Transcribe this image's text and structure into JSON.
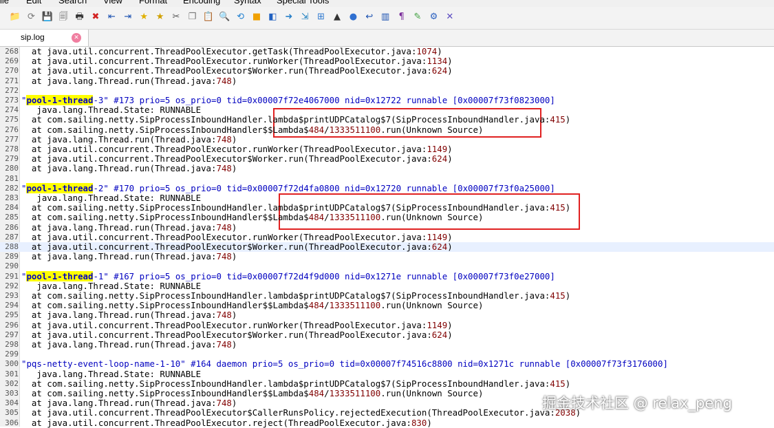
{
  "menu": [
    "ile",
    "Edit",
    "Search",
    "View",
    "Format",
    "Encoding",
    "Syntax",
    "Special Tools"
  ],
  "toolbar": [
    {
      "icon": "folder-open-icon",
      "glyph": "📁",
      "color": "#e2a31c"
    },
    {
      "icon": "reload-icon",
      "glyph": "⟳",
      "color": "#777777"
    },
    {
      "icon": "save-icon",
      "glyph": "💾",
      "color": "#555555"
    },
    {
      "icon": "save-all-icon",
      "glyph": "🗐",
      "color": "#555555"
    },
    {
      "icon": "print-icon",
      "glyph": "🖶",
      "color": "#333333"
    },
    {
      "icon": "close-icon",
      "glyph": "✖",
      "color": "#d22222"
    },
    {
      "icon": "outdent-icon",
      "glyph": "⇤",
      "color": "#1a50b0"
    },
    {
      "icon": "indent-icon",
      "glyph": "⇥",
      "color": "#1a50b0"
    },
    {
      "icon": "bookmark-add-icon",
      "glyph": "★",
      "color": "#e0b000"
    },
    {
      "icon": "bookmark-icon",
      "glyph": "★",
      "color": "#d0a000"
    },
    {
      "icon": "cut-icon",
      "glyph": "✂",
      "color": "#555555"
    },
    {
      "icon": "copy-icon",
      "glyph": "❐",
      "color": "#777777"
    },
    {
      "icon": "paste-icon",
      "glyph": "📋",
      "color": "#a07020"
    },
    {
      "icon": "find-icon",
      "glyph": "🔍",
      "color": "#2060c0"
    },
    {
      "icon": "replace-icon",
      "glyph": "⟲",
      "color": "#2080d0"
    },
    {
      "icon": "highlight-icon",
      "glyph": "■",
      "color": "#f0a000"
    },
    {
      "icon": "mark-icon",
      "glyph": "◧",
      "color": "#2060c0"
    },
    {
      "icon": "go-to-icon",
      "glyph": "➜",
      "color": "#2a80c8"
    },
    {
      "icon": "goto-line-icon",
      "glyph": "⇲",
      "color": "#2080c0"
    },
    {
      "icon": "windows-icon",
      "glyph": "⊞",
      "color": "#2f7ad0"
    },
    {
      "icon": "linux-icon",
      "glyph": "▲",
      "color": "#333333"
    },
    {
      "icon": "apple-icon",
      "glyph": "●",
      "color": "#3070d0"
    },
    {
      "icon": "word-wrap-icon",
      "glyph": "↩",
      "color": "#1a50b0"
    },
    {
      "icon": "column-icon",
      "glyph": "▥",
      "color": "#1a50b0"
    },
    {
      "icon": "pilcrow-icon",
      "glyph": "¶",
      "color": "#7a2a9a"
    },
    {
      "icon": "pencil-icon",
      "glyph": "✎",
      "color": "#40a040"
    },
    {
      "icon": "settings-icon",
      "glyph": "⚙",
      "color": "#2a60c0"
    },
    {
      "icon": "macro-icon",
      "glyph": "✕",
      "color": "#5a4ac0"
    }
  ],
  "tab": {
    "label": "sip.log",
    "close_glyph": "✕"
  },
  "lines": [
    {
      "n": "268",
      "segs": [
        [
          "  at java.util.concurrent.ThreadPoolExecutor.getTask(ThreadPoolExecutor.java:",
          ""
        ],
        [
          "1074",
          "num"
        ],
        [
          ")",
          ""
        ]
      ]
    },
    {
      "n": "269",
      "segs": [
        [
          "  at java.util.concurrent.ThreadPoolExecutor.runWorker(ThreadPoolExecutor.java:",
          ""
        ],
        [
          "1134",
          "num"
        ],
        [
          ")",
          ""
        ]
      ]
    },
    {
      "n": "270",
      "segs": [
        [
          "  at java.util.concurrent.ThreadPoolExecutor$Worker.run(ThreadPoolExecutor.java:",
          ""
        ],
        [
          "624",
          "num"
        ],
        [
          ")",
          ""
        ]
      ]
    },
    {
      "n": "271",
      "segs": [
        [
          "  at java.lang.Thread.run(Thread.java:",
          ""
        ],
        [
          "748",
          "num"
        ],
        [
          ")",
          ""
        ]
      ]
    },
    {
      "n": "272",
      "segs": []
    },
    {
      "n": "273",
      "segs": [
        [
          "\"",
          "str"
        ],
        [
          "pool-1-thread",
          "hl"
        ],
        [
          "-3\"",
          "str"
        ],
        [
          " #173 prio=5 os_prio=0 tid=0x00007f72e4067000 nid=0x12722 runnable [0x00007f73f0823000]",
          "kw"
        ]
      ]
    },
    {
      "n": "274",
      "segs": [
        [
          "   java.lang.Thread.State: RUNNABLE",
          ""
        ]
      ]
    },
    {
      "n": "275",
      "segs": [
        [
          "  at com.sailing.netty.SipProcessInboundHandler.lambda$printUDPCatalog$7(SipProcessInboundHandler.java:",
          ""
        ],
        [
          "415",
          "num"
        ],
        [
          ")",
          ""
        ]
      ]
    },
    {
      "n": "276",
      "segs": [
        [
          "  at com.sailing.netty.SipProcessInboundHandler$$Lambda$",
          ""
        ],
        [
          "484",
          "num"
        ],
        [
          "/",
          ""
        ],
        [
          "1333511100",
          "num"
        ],
        [
          ".run(Unknown Source)",
          ""
        ]
      ]
    },
    {
      "n": "277",
      "segs": [
        [
          "  at java.lang.Thread.run(Thread.java:",
          ""
        ],
        [
          "748",
          "num"
        ],
        [
          ")",
          ""
        ]
      ]
    },
    {
      "n": "278",
      "segs": [
        [
          "  at java.util.concurrent.ThreadPoolExecutor.runWorker(ThreadPoolExecutor.java:",
          ""
        ],
        [
          "1149",
          "num"
        ],
        [
          ")",
          ""
        ]
      ]
    },
    {
      "n": "279",
      "segs": [
        [
          "  at java.util.concurrent.ThreadPoolExecutor$Worker.run(ThreadPoolExecutor.java:",
          ""
        ],
        [
          "624",
          "num"
        ],
        [
          ")",
          ""
        ]
      ]
    },
    {
      "n": "280",
      "segs": [
        [
          "  at java.lang.Thread.run(Thread.java:",
          ""
        ],
        [
          "748",
          "num"
        ],
        [
          ")",
          ""
        ]
      ]
    },
    {
      "n": "281",
      "segs": []
    },
    {
      "n": "282",
      "segs": [
        [
          "\"",
          "str"
        ],
        [
          "pool-1-thread",
          "hl"
        ],
        [
          "-2\"",
          "str"
        ],
        [
          " #170 prio=5 os_prio=0 tid=0x00007f72d4fa0800 nid=0x12720 runnable [0x00007f73f0a25000]",
          "kw"
        ]
      ]
    },
    {
      "n": "283",
      "segs": [
        [
          "   java.lang.Thread.State: RUNNABLE",
          ""
        ]
      ]
    },
    {
      "n": "284",
      "segs": [
        [
          "  at com.sailing.netty.SipProcessInboundHandler.lambda$printUDPCatalog$7(SipProcessInboundHandler.java:",
          ""
        ],
        [
          "415",
          "num"
        ],
        [
          ")",
          ""
        ]
      ]
    },
    {
      "n": "285",
      "segs": [
        [
          "  at com.sailing.netty.SipProcessInboundHandler$$Lambda$",
          ""
        ],
        [
          "484",
          "num"
        ],
        [
          "/",
          ""
        ],
        [
          "1333511100",
          "num"
        ],
        [
          ".run(Unknown Source)",
          ""
        ]
      ]
    },
    {
      "n": "286",
      "segs": [
        [
          "  at java.lang.Thread.run(Thread.java:",
          ""
        ],
        [
          "748",
          "num"
        ],
        [
          ")",
          ""
        ]
      ]
    },
    {
      "n": "287",
      "segs": [
        [
          "  at java.util.concurrent.ThreadPoolExecutor.runWorker(ThreadPoolExecutor.java:",
          ""
        ],
        [
          "1149",
          "num"
        ],
        [
          ")",
          ""
        ]
      ]
    },
    {
      "n": "288",
      "segs": [
        [
          "  at java.util.concurrent.ThreadPoolExecutor$Worker.run(ThreadPoolExecutor.java:",
          ""
        ],
        [
          "624",
          "num"
        ],
        [
          ")",
          ""
        ]
      ],
      "current": true
    },
    {
      "n": "289",
      "segs": [
        [
          "  at java.lang.Thread.run(Thread.java:",
          ""
        ],
        [
          "748",
          "num"
        ],
        [
          ")",
          ""
        ]
      ]
    },
    {
      "n": "290",
      "segs": []
    },
    {
      "n": "291",
      "segs": [
        [
          "\"",
          "str"
        ],
        [
          "pool-1-thread",
          "hl"
        ],
        [
          "-1\"",
          "str"
        ],
        [
          " #167 prio=5 os_prio=0 tid=0x00007f72d4f9d000 nid=0x1271e runnable [0x00007f73f0e27000]",
          "kw"
        ]
      ]
    },
    {
      "n": "292",
      "segs": [
        [
          "   java.lang.Thread.State: RUNNABLE",
          ""
        ]
      ]
    },
    {
      "n": "293",
      "segs": [
        [
          "  at com.sailing.netty.SipProcessInboundHandler.lambda$printUDPCatalog$7(SipProcessInboundHandler.java:",
          ""
        ],
        [
          "415",
          "num"
        ],
        [
          ")",
          ""
        ]
      ]
    },
    {
      "n": "294",
      "segs": [
        [
          "  at com.sailing.netty.SipProcessInboundHandler$$Lambda$",
          ""
        ],
        [
          "484",
          "num"
        ],
        [
          "/",
          ""
        ],
        [
          "1333511100",
          "num"
        ],
        [
          ".run(Unknown Source)",
          ""
        ]
      ]
    },
    {
      "n": "295",
      "segs": [
        [
          "  at java.lang.Thread.run(Thread.java:",
          ""
        ],
        [
          "748",
          "num"
        ],
        [
          ")",
          ""
        ]
      ]
    },
    {
      "n": "296",
      "segs": [
        [
          "  at java.util.concurrent.ThreadPoolExecutor.runWorker(ThreadPoolExecutor.java:",
          ""
        ],
        [
          "1149",
          "num"
        ],
        [
          ")",
          ""
        ]
      ]
    },
    {
      "n": "297",
      "segs": [
        [
          "  at java.util.concurrent.ThreadPoolExecutor$Worker.run(ThreadPoolExecutor.java:",
          ""
        ],
        [
          "624",
          "num"
        ],
        [
          ")",
          ""
        ]
      ]
    },
    {
      "n": "298",
      "segs": [
        [
          "  at java.lang.Thread.run(Thread.java:",
          ""
        ],
        [
          "748",
          "num"
        ],
        [
          ")",
          ""
        ]
      ]
    },
    {
      "n": "299",
      "segs": []
    },
    {
      "n": "300",
      "segs": [
        [
          "\"pqs-netty-event-loop-name-1-10\"",
          "str"
        ],
        [
          " #164 daemon prio=5 os_prio=0 tid=0x00007f74516c8800 nid=0x1271c runnable [0x00007f73f3176000]",
          "kw"
        ]
      ]
    },
    {
      "n": "301",
      "segs": [
        [
          "   java.lang.Thread.State: RUNNABLE",
          ""
        ]
      ]
    },
    {
      "n": "302",
      "segs": [
        [
          "  at com.sailing.netty.SipProcessInboundHandler.lambda$printUDPCatalog$7(SipProcessInboundHandler.java:",
          ""
        ],
        [
          "415",
          "num"
        ],
        [
          ")",
          ""
        ]
      ]
    },
    {
      "n": "303",
      "segs": [
        [
          "  at com.sailing.netty.SipProcessInboundHandler$$Lambda$",
          ""
        ],
        [
          "484",
          "num"
        ],
        [
          "/",
          ""
        ],
        [
          "1333511100",
          "num"
        ],
        [
          ".run(Unknown Source)",
          ""
        ]
      ]
    },
    {
      "n": "304",
      "segs": [
        [
          "  at java.lang.Thread.run(Thread.java:",
          ""
        ],
        [
          "748",
          "num"
        ],
        [
          ")",
          ""
        ]
      ]
    },
    {
      "n": "305",
      "segs": [
        [
          "  at java.util.concurrent.ThreadPoolExecutor$CallerRunsPolicy.rejectedExecution(ThreadPoolExecutor.java:",
          ""
        ],
        [
          "2038",
          "num"
        ],
        [
          ")",
          ""
        ]
      ]
    },
    {
      "n": "306",
      "segs": [
        [
          "  at java.util.concurrent.ThreadPoolExecutor.reject(ThreadPoolExecutor.java:",
          ""
        ],
        [
          "830",
          "num"
        ],
        [
          ")",
          ""
        ]
      ]
    }
  ],
  "watermark": "掘金技术社区 @ relax_peng"
}
